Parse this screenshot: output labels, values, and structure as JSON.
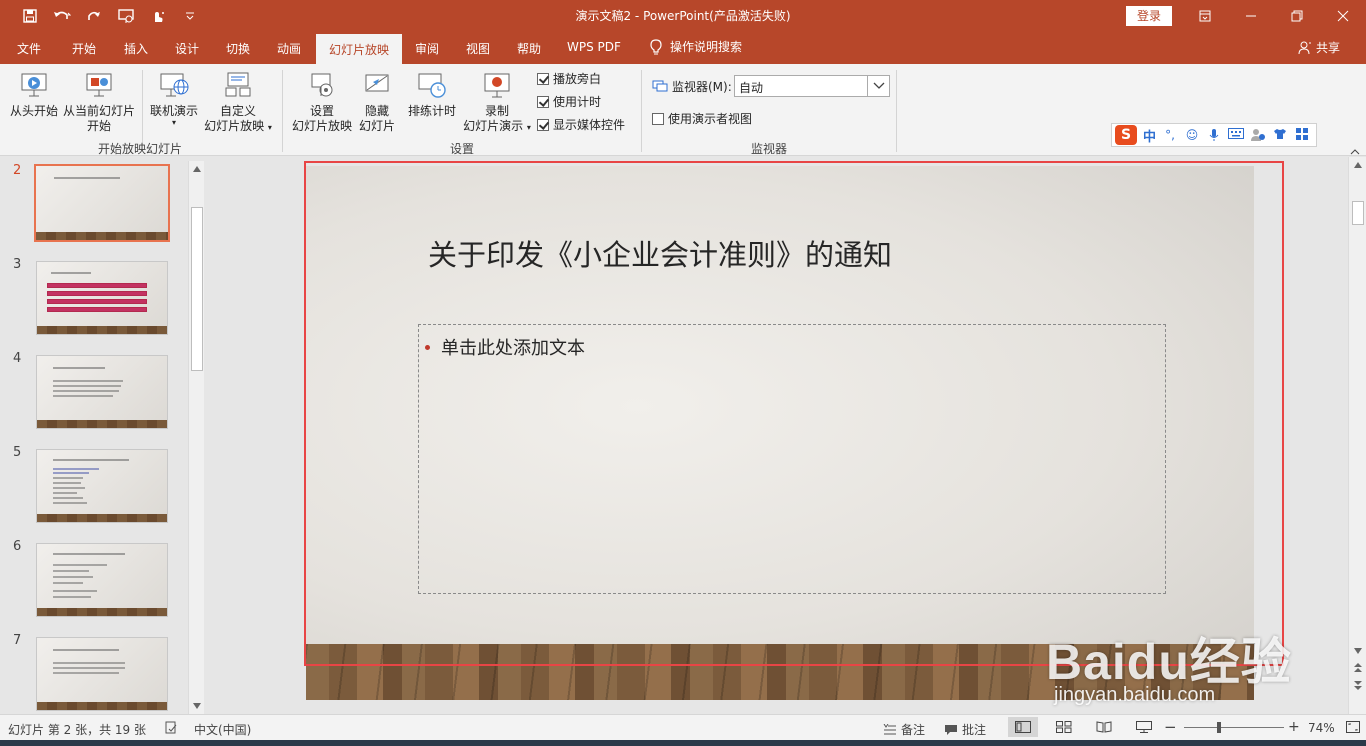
{
  "window": {
    "title": "演示文稿2  -  PowerPoint(产品激活失败)",
    "login": "登录"
  },
  "tabs": [
    "文件",
    "开始",
    "插入",
    "设计",
    "切换",
    "动画",
    "幻灯片放映",
    "审阅",
    "视图",
    "帮助",
    "WPS PDF"
  ],
  "active_tab": "幻灯片放映",
  "tell_me": "操作说明搜索",
  "share": "共享",
  "ribbon": {
    "start_group": {
      "label": "开始放映幻灯片",
      "from_beginning": "从头开始",
      "from_current_1": "从当前幻灯片",
      "from_current_2": "开始",
      "online_1": "联机演示",
      "custom_1": "自定义",
      "custom_2": "幻灯片放映"
    },
    "setup_group": {
      "label": "设置",
      "setup_1": "设置",
      "setup_2": "幻灯片放映",
      "hide_1": "隐藏",
      "hide_2": "幻灯片",
      "rehearse": "排练计时",
      "record_1": "录制",
      "record_2": "幻灯片演示",
      "chk_narration": "播放旁白",
      "chk_timings": "使用计时",
      "chk_media": "显示媒体控件"
    },
    "monitors_group": {
      "label": "监视器",
      "monitor_label": "监视器(M):",
      "monitor_value": "自动",
      "presenter_view": "使用演示者视图"
    },
    "ime": {
      "logo": "S",
      "lang": "中"
    }
  },
  "thumbnails": [
    {
      "num": "2"
    },
    {
      "num": "3"
    },
    {
      "num": "4"
    },
    {
      "num": "5"
    },
    {
      "num": "6"
    },
    {
      "num": "7"
    }
  ],
  "slide": {
    "title": "关于印发《小企业会计准则》的通知",
    "placeholder": "单击此处添加文本"
  },
  "watermark": {
    "brand": "Bai\u0001经验",
    "brand_text": "Baidu经验",
    "url": "jingyan.baidu.com"
  },
  "status": {
    "slide_info": "幻灯片 第 2 张，共 19 张",
    "language": "中文(中国)",
    "notes": "备注",
    "comments": "批注",
    "zoom": "74%"
  },
  "colors": {
    "accent": "#b7472a",
    "active_tab_text": "#b7472a",
    "selection_frame": "#e84545"
  }
}
